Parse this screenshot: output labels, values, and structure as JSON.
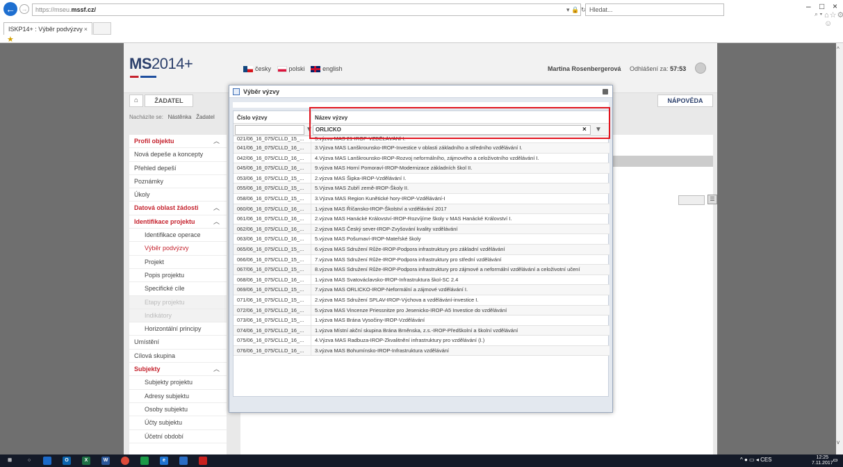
{
  "browser": {
    "url_prefix": "https://mseu.",
    "url_domain": "mssf.cz/",
    "search_placeholder": "Hledat...",
    "tab_title": "ISKP14+ : Výběr podvýzvy",
    "tab_close": "×",
    "secure_icons": "▾ 🔒 ↻",
    "search_dropdown": "⌕ ▾",
    "toolbar_icons": "⌂☆⚙☺",
    "window_min": "–",
    "window_max": "□",
    "window_close": "×"
  },
  "header": {
    "logo_text": "MS",
    "logo_num": "2014+",
    "languages": [
      {
        "label": "česky"
      },
      {
        "label": "polski"
      },
      {
        "label": "english"
      }
    ],
    "user_name": "Martina Rosenbergerová",
    "logout_label": "Odhlášení za:",
    "logout_time": "57:53"
  },
  "nav": {
    "zadatel": "ŽADATEL",
    "napoveda": "NÁPOVĚDA",
    "breadcrumb_label": "Nacházíte se:",
    "breadcrumb_1": "Nástěnka",
    "breadcrumb_2": "Žadatel"
  },
  "sidebar": {
    "items": [
      {
        "label": "Profil objektu",
        "type": "section"
      },
      {
        "label": "Nová depeše a koncepty",
        "type": "item"
      },
      {
        "label": "Přehled depeší",
        "type": "item"
      },
      {
        "label": "Poznámky",
        "type": "item"
      },
      {
        "label": "Úkoly",
        "type": "item"
      },
      {
        "label": "Datová oblast žádosti",
        "type": "section"
      },
      {
        "label": "Identifikace projektu",
        "type": "section"
      },
      {
        "label": "Identifikace operace",
        "type": "sub"
      },
      {
        "label": "Výběr podvýzvy",
        "type": "sub-active"
      },
      {
        "label": "Projekt",
        "type": "sub"
      },
      {
        "label": "Popis projektu",
        "type": "sub"
      },
      {
        "label": "Specifické cíle",
        "type": "sub"
      },
      {
        "label": "Etapy projektu",
        "type": "sub-disabled"
      },
      {
        "label": "Indikátory",
        "type": "sub-disabled"
      },
      {
        "label": "Horizontální principy",
        "type": "sub"
      },
      {
        "label": "Umístění",
        "type": "item"
      },
      {
        "label": "Cílová skupina",
        "type": "item"
      },
      {
        "label": "Subjekty",
        "type": "section"
      },
      {
        "label": "Subjekty projektu",
        "type": "sub"
      },
      {
        "label": "Adresy subjektu",
        "type": "sub"
      },
      {
        "label": "Osoby subjektu",
        "type": "sub"
      },
      {
        "label": "Účty subjektu",
        "type": "sub"
      },
      {
        "label": "Účetní období",
        "type": "sub"
      }
    ]
  },
  "modal": {
    "title": "Výběr výzvy",
    "col_cislo": "Číslo výzvy",
    "col_nazev": "Název výzvy",
    "filter_value": "ORLICKO",
    "first_row_partial": "5.výzva MAS 21-IROP-VZDĚLÁVÁNÍ I.",
    "rows": [
      {
        "cislo": "021/06_16_075/CLLD_15_...",
        "nazev": "5.výzva MAS 21-IROP-VZDĚLÁVÁNÍ I."
      },
      {
        "cislo": "041/06_16_075/CLLD_16_...",
        "nazev": "3.Výzva MAS Lanškrounsko-IROP-Investice v oblasti základního a středního vzdělávání I."
      },
      {
        "cislo": "042/06_16_075/CLLD_16_...",
        "nazev": "4.Výzva MAS Lanškrounsko-IROP-Rozvoj neformálního, zájmového a celoživotního vzdělávání I."
      },
      {
        "cislo": "045/06_16_075/CLLD_16_...",
        "nazev": "9.výzva MAS Horní Pomoraví-IROP-Modernizace základních škol II."
      },
      {
        "cislo": "053/06_16_075/CLLD_15_...",
        "nazev": "2.výzva MAS Šipka-IROP-Vzdělávání I."
      },
      {
        "cislo": "055/06_16_075/CLLD_15_...",
        "nazev": "5.Výzva MAS Zubří země-IROP-Školy II."
      },
      {
        "cislo": "058/06_16_075/CLLD_15_...",
        "nazev": "3.Výzva MAS Region Kunětické hory-IROP-Vzdělávání-I"
      },
      {
        "cislo": "060/06_16_075/CLLD_16_...",
        "nazev": "1.výzva MAS Říčansko-IROP-Školství a vzdělávání 2017"
      },
      {
        "cislo": "061/06_16_075/CLLD_16_...",
        "nazev": "2.výzva MAS Hanácké Království-IROP-Rozvíjíme školy v MAS Hanácké Království I."
      },
      {
        "cislo": "062/06_16_075/CLLD_16_...",
        "nazev": "2.výzva MAS Český sever-IROP-Zvyšování kvality vzdělávání"
      },
      {
        "cislo": "063/06_16_075/CLLD_16_...",
        "nazev": "5.výzva MAS Pošumaví-IROP-Mateřské školy"
      },
      {
        "cislo": "065/06_16_075/CLLD_15_...",
        "nazev": "6.výzva MAS Sdružení Růže-IROP-Podpora infrastruktury pro základní vzdělávání"
      },
      {
        "cislo": "066/06_16_075/CLLD_15_...",
        "nazev": "7.výzva MAS Sdružení Růže-IROP-Podpora infrastruktury pro střední vzdělávání"
      },
      {
        "cislo": "067/06_16_075/CLLD_15_...",
        "nazev": "8.výzva MAS Sdružení Růže-IROP-Podpora infrastruktury pro zájmové a neformální vzdělávání a celoživotní učení"
      },
      {
        "cislo": "068/06_16_075/CLLD_16_...",
        "nazev": "1.výzva MAS Svatováclavsko-IROP-Infrastruktura škol-SC 2.4"
      },
      {
        "cislo": "069/06_16_075/CLLD_15_...",
        "nazev": "7.výzva MAS ORLICKO-IROP-Neformální a zájmové vzdělávání I."
      },
      {
        "cislo": "071/06_16_075/CLLD_15_...",
        "nazev": "2.výzva MAS Sdružení SPLAV-IROP-Výchova a vzdělávání-investice I."
      },
      {
        "cislo": "072/06_16_075/CLLD_16_...",
        "nazev": "5.výzva MAS Vincenze Priessnitze pro Jesenicko-IROP-A5 Investice do vzdělávání"
      },
      {
        "cislo": "073/06_16_075/CLLD_15_...",
        "nazev": "1.výzva MAS Brána Vysočiny-IROP-Vzdělávání"
      },
      {
        "cislo": "074/06_16_075/CLLD_16_...",
        "nazev": "1.výzva Místní akční skupina Brána Brněnska, z.s.-IROP-Předškolní a školní vzdělávání"
      },
      {
        "cislo": "075/06_16_075/CLLD_16_...",
        "nazev": "4.Výzva MAS Radbuza-IROP-Zkvalitnění infrastruktury pro vzdělávání (I.)"
      },
      {
        "cislo": "076/06_16_075/CLLD_16_...",
        "nazev": "3.výzva MAS Bohumínsko-IROP-Infrastruktura vzdělávání"
      }
    ]
  },
  "taskbar": {
    "lang": "CES",
    "time": "12:25",
    "date": "7.11.2017"
  },
  "colors": {
    "accent": "#c5222d",
    "brand": "#2b3f6b",
    "highlight": "#e2141e"
  }
}
